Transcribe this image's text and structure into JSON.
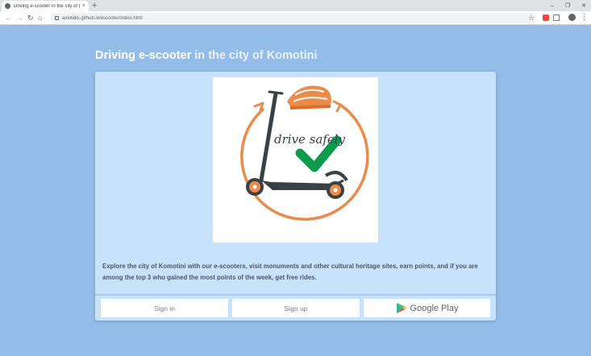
{
  "browser": {
    "tab_title": "Driving e-scooter in the city of K",
    "url": "axiotidis.github.io/escooter/index.html",
    "new_tab_label": "+",
    "close_tab_label": "×",
    "window_controls": {
      "minimize": "–",
      "maximize": "❐",
      "close": "✕"
    }
  },
  "page": {
    "heading_highlight": "Driving e-scooter",
    "heading_rest": " in the city of Komotini",
    "logo_text": "drive safely",
    "description": "Explore the city of Komotini with our e-scooters, visit monuments and other cultural heritage sites, earn points, and if you are among the top 3 who gained the most points of the week, get free rides.",
    "buttons": {
      "sign_in": "Sign in",
      "sign_up": "Sign up",
      "google_play": "Google Play"
    }
  },
  "colors": {
    "page_bg": "#93bde8",
    "card_bg": "#c7e2fb",
    "accent_orange": "#ec8a4a",
    "check_green": "#0c9a4d",
    "scooter_dark": "#3a4145"
  },
  "icons": {
    "back": "back-arrow-icon",
    "forward": "forward-arrow-icon",
    "reload": "reload-icon",
    "home": "home-icon",
    "bookmark": "star-icon",
    "menu": "kebab-menu-icon"
  }
}
